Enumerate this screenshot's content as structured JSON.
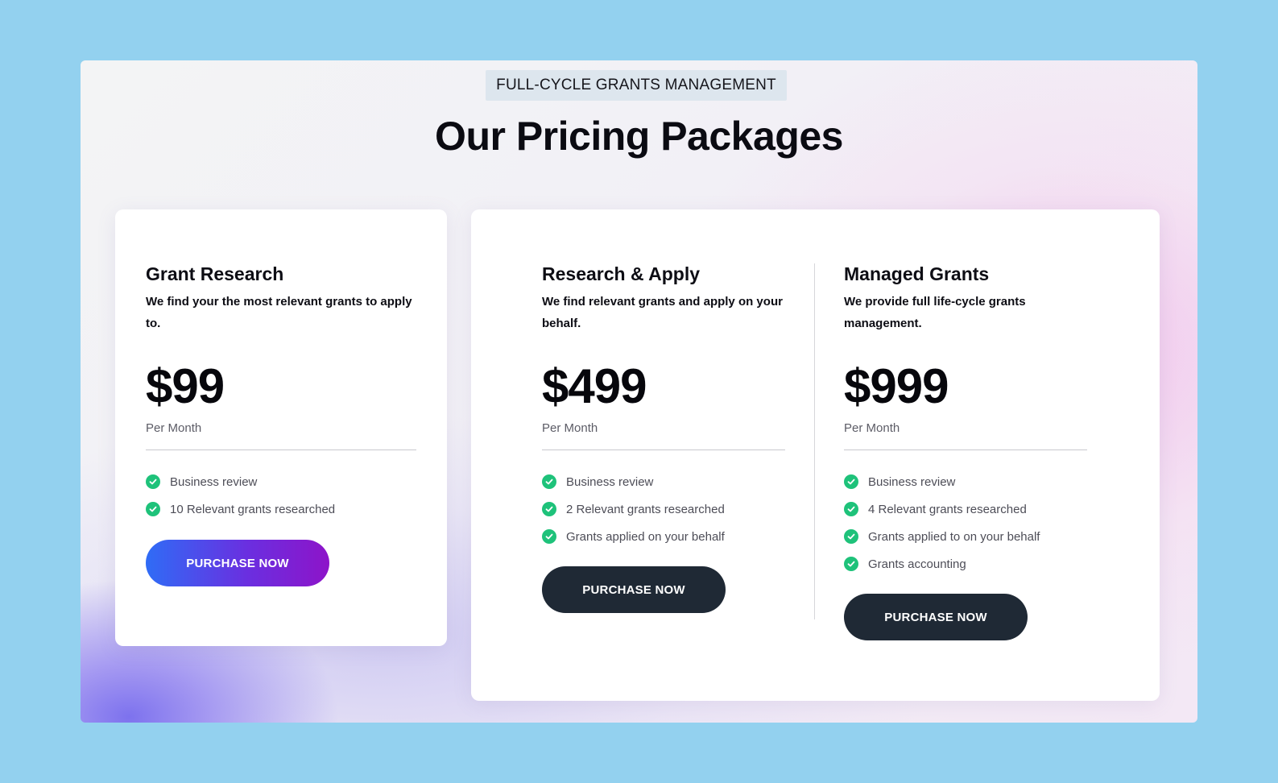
{
  "header": {
    "eyebrow": "FULL-CYCLE GRANTS MANAGEMENT",
    "title": "Our Pricing Packages"
  },
  "plans": [
    {
      "name": "Grant Research",
      "description": "We find your the most relevant grants to apply to.",
      "price": "$99",
      "period": "Per Month",
      "features": [
        "Business review",
        "10 Relevant grants researched"
      ],
      "cta": "PURCHASE NOW"
    },
    {
      "name": "Research & Apply",
      "description": "We find relevant grants and apply on your behalf.",
      "price": "$499",
      "period": "Per Month",
      "features": [
        "Business review",
        "2 Relevant grants researched",
        "Grants applied on your behalf"
      ],
      "cta": "PURCHASE NOW"
    },
    {
      "name": "Managed Grants",
      "description": "We provide full life-cycle grants management.",
      "price": "$999",
      "period": "Per Month",
      "features": [
        "Business review",
        "4 Relevant grants researched",
        "Grants applied to on your behalf",
        "Grants accounting"
      ],
      "cta": "PURCHASE NOW"
    }
  ],
  "icons": {
    "feature_bullet": "check-circle-icon"
  },
  "colors": {
    "page_background": "#93d1ef",
    "check_green": "#1ec27a",
    "dark_button": "#1f2935",
    "gradient_button_start": "#2f6cf6",
    "gradient_button_end": "#8d14c9"
  }
}
